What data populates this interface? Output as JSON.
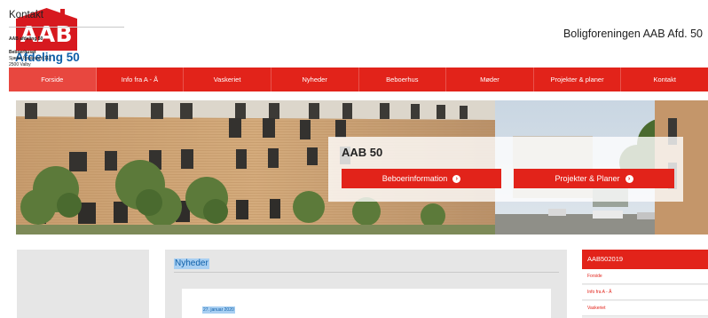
{
  "header": {
    "logo_text": "AAB",
    "logo_subtitle": "Afdeling 50",
    "site_title": "Boligforeningen AAB Afd. 50"
  },
  "nav": {
    "items": [
      {
        "label": "Forside",
        "active": true
      },
      {
        "label": "Info fra A - Å"
      },
      {
        "label": "Vaskeriet"
      },
      {
        "label": "Nyheder"
      },
      {
        "label": "Beboerhus"
      },
      {
        "label": "Møder"
      },
      {
        "label": "Projekter & planer"
      },
      {
        "label": "Kontakt"
      }
    ]
  },
  "hero": {
    "title": "AAB 50",
    "button_beboer": "Beboerinformation",
    "button_projekter": "Projekter & Planer",
    "arrow_icon": "circle-chevron-right-icon"
  },
  "contact": {
    "title": "Kontakt",
    "org": "AAB afdeling 50",
    "place": "Beboerhuset",
    "address": "Sjælør Boulevard 111",
    "city": "2500 Valby"
  },
  "news": {
    "heading": "Nyheder",
    "date": "27. januar 2020"
  },
  "sidebar": {
    "header": "AAB502019",
    "items": [
      "Forside",
      "Info fra A - Å",
      "Vaskeriet"
    ]
  },
  "colors": {
    "brand_red": "#e2231a",
    "logo_blue": "#0e5fa8",
    "selection_blue": "#a8cff2"
  }
}
